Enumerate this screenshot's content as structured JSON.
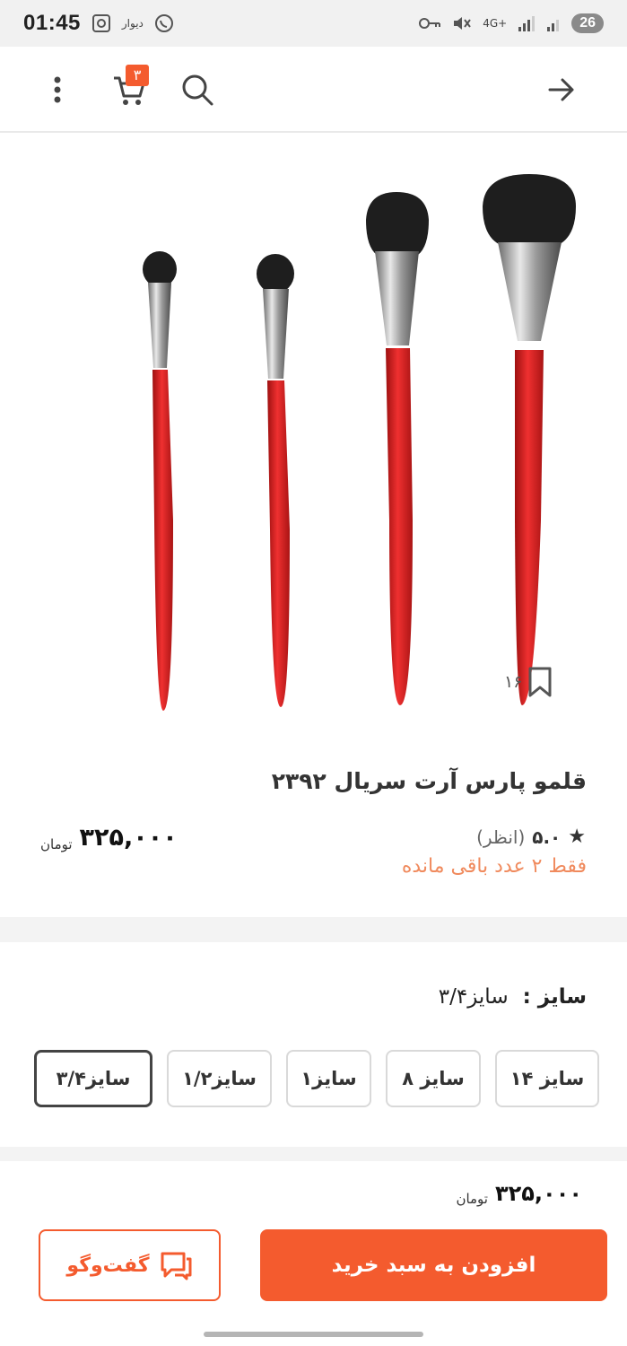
{
  "status_bar": {
    "time": "01:45",
    "divar_label": "دیوار",
    "network": "4G+",
    "battery": "26"
  },
  "header": {
    "cart_count": "۳",
    "icons": [
      "back-arrow-icon",
      "search-icon",
      "cart-icon",
      "more-vertical-icon"
    ]
  },
  "product": {
    "title": "قلمو پارس آرت سریال ۲۳۹۲",
    "bookmark_count": "۱۶",
    "rating_value": "۵.۰",
    "rating_reviews": "(انظر)",
    "stock_note": "فقط ۲ عدد باقی مانده",
    "price": "۳۲۵,۰۰۰",
    "currency": "تومان"
  },
  "size": {
    "label": "سایز :",
    "selected_value": "سایز۳/۴",
    "options": [
      "سایز ۱۴",
      "سایز ۸",
      "سایز۱",
      "سایز۱/۲",
      "سایز۳/۴"
    ],
    "selected_index": 4
  },
  "bottom_bar": {
    "price": "۳۲۵,۰۰۰",
    "currency": "تومان",
    "chat_label": "گفت‌وگو",
    "add_to_cart_label": "افزودن به سبد خرید"
  },
  "colors": {
    "accent": "#f45b2e",
    "stock_note": "#f08a5d",
    "brush_handle": "#d8201f"
  }
}
